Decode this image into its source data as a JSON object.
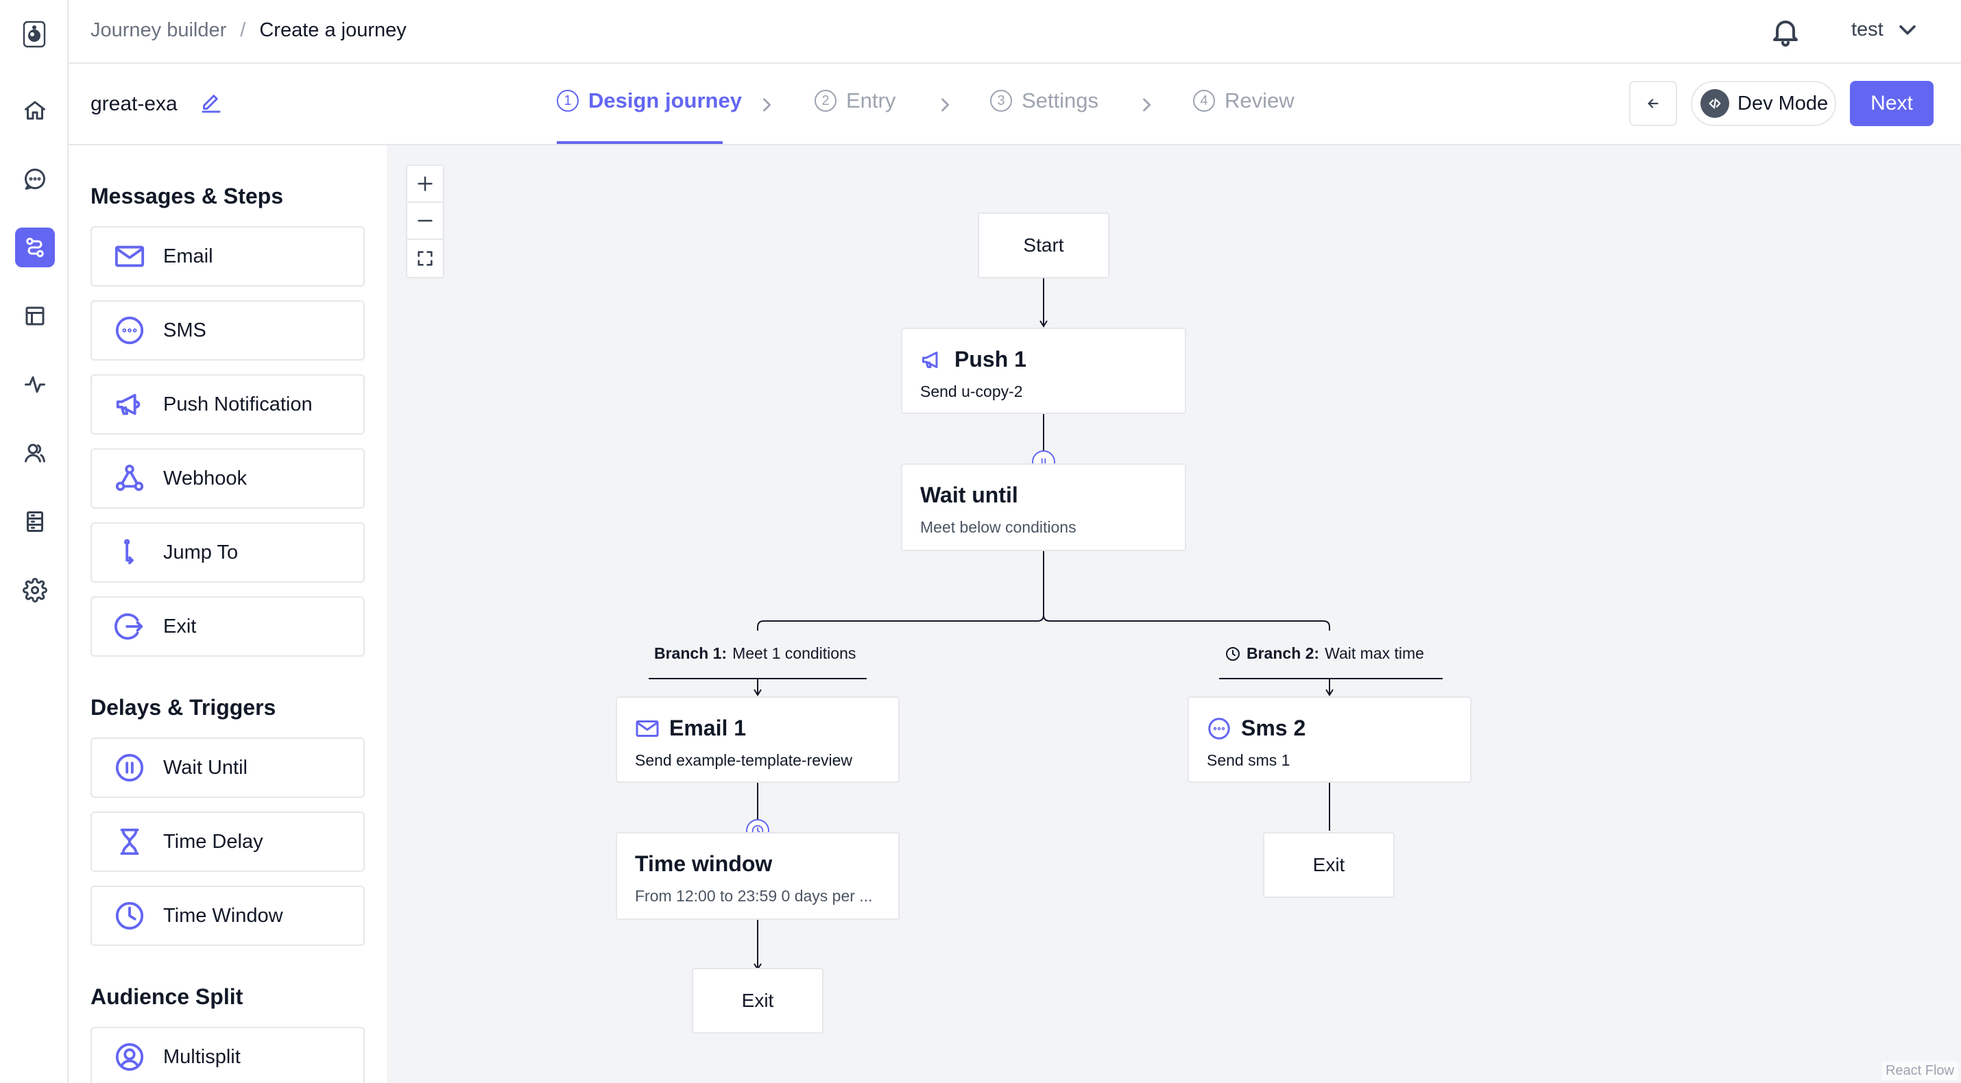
{
  "rail": {
    "items": [
      {
        "name": "home",
        "active": false
      },
      {
        "name": "messages",
        "active": false
      },
      {
        "name": "journeys",
        "active": true
      },
      {
        "name": "templates",
        "active": false
      },
      {
        "name": "analytics",
        "active": false
      },
      {
        "name": "people",
        "active": false
      },
      {
        "name": "data",
        "active": false
      },
      {
        "name": "settings",
        "active": false
      }
    ]
  },
  "header": {
    "breadcrumb_parent": "Journey builder",
    "breadcrumb_separator": "/",
    "breadcrumb_current": "Create a journey",
    "user_name": "test"
  },
  "journey": {
    "name": "great-exa"
  },
  "steps": [
    {
      "num": "1",
      "label": "Design journey",
      "active": true
    },
    {
      "num": "2",
      "label": "Entry",
      "active": false
    },
    {
      "num": "3",
      "label": "Settings",
      "active": false
    },
    {
      "num": "4",
      "label": "Review",
      "active": false
    }
  ],
  "actions": {
    "dev_mode_label": "Dev Mode",
    "next_label": "Next"
  },
  "sidebar": {
    "sections": [
      {
        "title": "Messages & Steps",
        "items": [
          "Email",
          "SMS",
          "Push Notification",
          "Webhook",
          "Jump To",
          "Exit"
        ]
      },
      {
        "title": "Delays & Triggers",
        "items": [
          "Wait Until",
          "Time Delay",
          "Time Window"
        ]
      },
      {
        "title": "Audience Split",
        "items": [
          "Multisplit"
        ]
      }
    ]
  },
  "flow": {
    "start": "Start",
    "push": {
      "title": "Push 1",
      "send_label": "Send",
      "template": "u-copy-2"
    },
    "wait": {
      "title": "Wait until",
      "subtitle": "Meet below conditions"
    },
    "branch1": {
      "label": "Branch 1:",
      "text": "Meet 1 conditions"
    },
    "branch2": {
      "label": "Branch 2:",
      "text": "Wait max time"
    },
    "email": {
      "title": "Email 1",
      "send_label": "Send",
      "template": "example-template-review"
    },
    "sms": {
      "title": "Sms 2",
      "send_label": "Send",
      "template": "sms 1"
    },
    "window": {
      "title": "Time window",
      "subtitle": "From 12:00 to 23:59 0 days per ..."
    },
    "exit_left": "Exit",
    "exit_right": "Exit"
  },
  "attribution": "React Flow",
  "colors": {
    "accent": "#6366f1",
    "canvas_bg": "#f3f4f6",
    "border": "#e5e7eb"
  }
}
